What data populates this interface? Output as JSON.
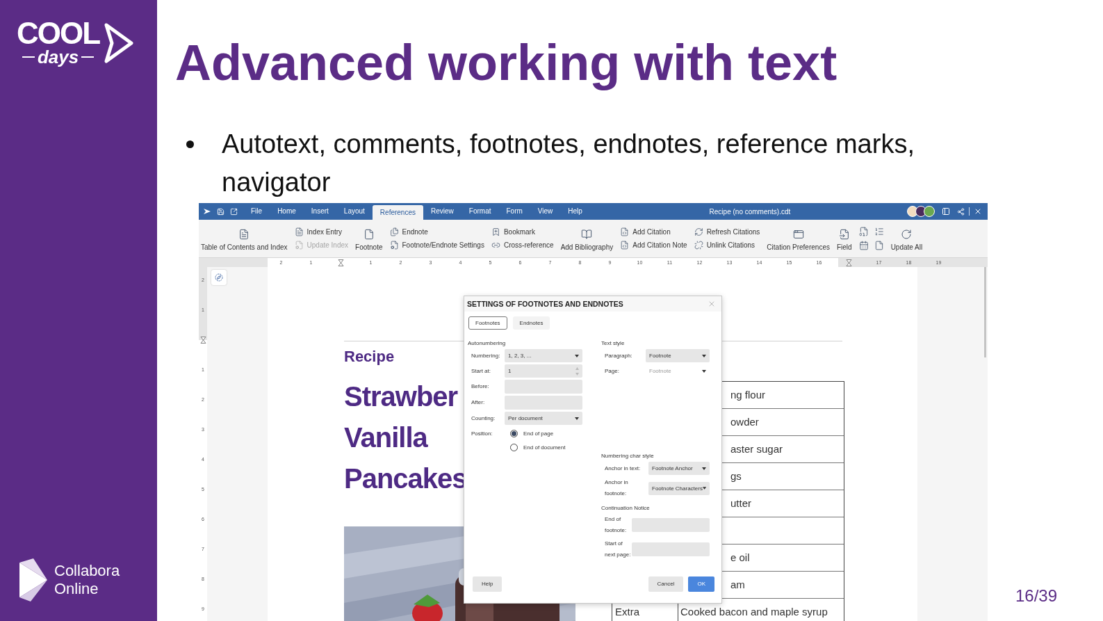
{
  "sidebar": {
    "logo_top": {
      "word": "COOL",
      "sub": "days"
    },
    "logo_bottom": [
      "Collabora",
      "Online"
    ]
  },
  "title": "Advanced working with text",
  "bullets": [
    "Autotext, comments, footnotes, endnotes, reference marks, navigator"
  ],
  "screenshot": {
    "menu_tabs": [
      {
        "label": "File",
        "selected": false
      },
      {
        "label": "Home",
        "selected": false
      },
      {
        "label": "Insert",
        "selected": false
      },
      {
        "label": "Layout",
        "selected": false
      },
      {
        "label": "References",
        "selected": true
      },
      {
        "label": "Review",
        "selected": false
      },
      {
        "label": "Format",
        "selected": false
      },
      {
        "label": "Form",
        "selected": false
      },
      {
        "label": "View",
        "selected": false
      },
      {
        "label": "Help",
        "selected": false
      }
    ],
    "document_title": "Recipe (no comments).cdt",
    "ribbon": [
      {
        "kind": "large",
        "label": "Table of Contents and Index"
      },
      {
        "kind": "stack",
        "items": [
          {
            "label": "Index Entry",
            "disabled": false
          },
          {
            "label": "Update Index",
            "disabled": true
          }
        ]
      },
      {
        "kind": "large",
        "label": "Footnote"
      },
      {
        "kind": "stack",
        "items": [
          {
            "label": "Endnote",
            "disabled": false
          },
          {
            "label": "Footnote/Endnote Settings",
            "disabled": false
          }
        ]
      },
      {
        "kind": "stack",
        "items": [
          {
            "label": "Bookmark",
            "disabled": false
          },
          {
            "label": "Cross-reference",
            "disabled": false
          }
        ]
      },
      {
        "kind": "large",
        "label": "Add Bibliography"
      },
      {
        "kind": "stack",
        "items": [
          {
            "label": "Add Citation",
            "disabled": false
          },
          {
            "label": "Add Citation Note",
            "disabled": false
          }
        ]
      },
      {
        "kind": "stack",
        "items": [
          {
            "label": "Refresh Citations",
            "disabled": false
          },
          {
            "label": "Unlink Citations",
            "disabled": false
          }
        ]
      },
      {
        "kind": "large",
        "label": "Citation Preferences"
      },
      {
        "kind": "large",
        "label": "Field"
      },
      {
        "kind": "icon-grid"
      },
      {
        "kind": "large",
        "label": "Update All"
      }
    ],
    "horizontal_ruler": [
      {
        "kind": "number",
        "label": "2"
      },
      {
        "kind": "number",
        "label": "1"
      },
      {
        "kind": "marker"
      },
      {
        "kind": "number",
        "label": "1"
      },
      {
        "kind": "number",
        "label": "2"
      },
      {
        "kind": "number",
        "label": "3"
      },
      {
        "kind": "number",
        "label": "4"
      },
      {
        "kind": "number",
        "label": "5"
      },
      {
        "kind": "number",
        "label": "6"
      },
      {
        "kind": "number",
        "label": "7"
      },
      {
        "kind": "number",
        "label": "8"
      },
      {
        "kind": "number",
        "label": "9"
      },
      {
        "kind": "number",
        "label": "10"
      },
      {
        "kind": "number",
        "label": "11"
      },
      {
        "kind": "number",
        "label": "12"
      },
      {
        "kind": "number",
        "label": "13"
      },
      {
        "kind": "number",
        "label": "14"
      },
      {
        "kind": "number",
        "label": "15"
      },
      {
        "kind": "number",
        "label": "16"
      },
      {
        "kind": "marker"
      },
      {
        "kind": "number",
        "label": "17"
      },
      {
        "kind": "number",
        "label": "18"
      },
      {
        "kind": "number",
        "label": "19"
      }
    ],
    "vertical_ruler": [
      {
        "kind": "number",
        "label": "2"
      },
      {
        "kind": "number",
        "label": "1"
      },
      {
        "kind": "marker"
      },
      {
        "kind": "number",
        "label": "1"
      },
      {
        "kind": "number",
        "label": "2"
      },
      {
        "kind": "number",
        "label": "3"
      },
      {
        "kind": "number",
        "label": "4"
      },
      {
        "kind": "number",
        "label": "5"
      },
      {
        "kind": "number",
        "label": "6"
      },
      {
        "kind": "number",
        "label": "7"
      },
      {
        "kind": "number",
        "label": "8"
      },
      {
        "kind": "number",
        "label": "9"
      }
    ],
    "document": {
      "heading": "Recipe",
      "title_lines": [
        "Strawber",
        "Vanilla",
        "Pancakes"
      ],
      "table": {
        "rows": [
          {
            "column_2": "ng flour"
          },
          {
            "column_2": "owder"
          },
          {
            "column_2": "aster sugar"
          },
          {
            "column_2": "gs"
          },
          {
            "column_2": "utter"
          },
          {},
          {
            "column_2": "e oil"
          },
          {
            "column_2": "am"
          },
          {
            "column_1": "Extra",
            "column_2": "Cooked bacon and maple syrup"
          }
        ]
      }
    },
    "dialog": {
      "title": "SETTINGS OF FOOTNOTES AND ENDNOTES",
      "tabs": [
        {
          "label": "Footnotes",
          "selected": true
        },
        {
          "label": "Endnotes",
          "selected": false
        }
      ],
      "autonumbering": {
        "heading": "Autonumbering",
        "fields": [
          {
            "kind": "select",
            "label": "Numbering:",
            "value": "1, 2, 3, ..."
          },
          {
            "kind": "spin",
            "label": "Start at:",
            "value": "1"
          },
          {
            "kind": "text",
            "label": "Before:"
          },
          {
            "kind": "text",
            "label": "After:"
          },
          {
            "kind": "select",
            "label": "Counting:",
            "value": "Per document"
          }
        ],
        "position": {
          "label": "Position:",
          "options": [
            {
              "label": "End of page",
              "selected": true
            },
            {
              "label": "End of document",
              "selected": false
            }
          ]
        }
      },
      "text_style": {
        "heading": "Text style",
        "fields": [
          {
            "kind": "select",
            "label": "Paragraph:",
            "value": "Footnote",
            "disabled": false
          },
          {
            "kind": "select",
            "label": "Page:",
            "value": "Footnote",
            "disabled": true
          }
        ]
      },
      "numbering_char_style": {
        "heading": "Numbering char style",
        "fields": [
          {
            "kind": "select",
            "label": "Anchor in text:",
            "value": "Footnote Anchor"
          },
          {
            "kind": "select",
            "label": "Anchor in footnote:",
            "value": "Footnote Characters"
          }
        ]
      },
      "continuation_notice": {
        "heading": "Continuation Notice",
        "fields": [
          {
            "kind": "text",
            "label": "End of footnote:"
          },
          {
            "kind": "text",
            "label": "Start of next page:"
          }
        ]
      },
      "buttons": [
        {
          "kind": "help",
          "label": "Help"
        },
        {
          "kind": "secondary",
          "label": "Cancel"
        },
        {
          "kind": "primary",
          "label": "OK"
        }
      ]
    }
  },
  "page_number": "16/39"
}
